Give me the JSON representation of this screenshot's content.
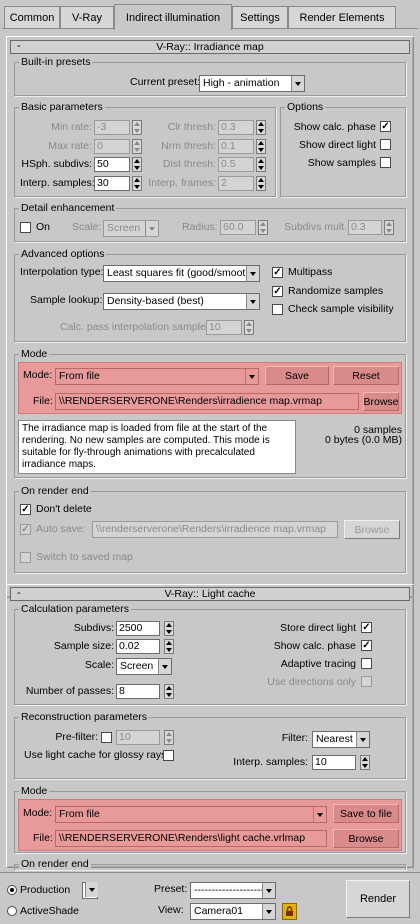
{
  "tabs": [
    {
      "label": "Common"
    },
    {
      "label": "V-Ray"
    },
    {
      "label": "Indirect illumination"
    },
    {
      "label": "Settings"
    },
    {
      "label": "Render Elements"
    }
  ],
  "irradiance": {
    "rollout_title": "V-Ray:: Irradiance map",
    "collapse": "-",
    "presets": {
      "group": "Built-in presets",
      "label": "Current preset:",
      "value": "High - animation"
    },
    "basic": {
      "group": "Basic parameters",
      "min_rate_label": "Min rate:",
      "min_rate": "-3",
      "max_rate_label": "Max rate:",
      "max_rate": "0",
      "hsph_label": "HSph. subdivs:",
      "hsph": "50",
      "interp_label": "Interp. samples:",
      "interp": "30",
      "clr_label": "Clr thresh:",
      "clr": "0.3",
      "nrm_label": "Nrm thresh:",
      "nrm": "0.1",
      "dist_label": "Dist thresh:",
      "dist": "0.5",
      "frames_label": "Interp. frames:",
      "frames": "2"
    },
    "options": {
      "group": "Options",
      "show_calc": "Show calc. phase",
      "show_direct": "Show direct light",
      "show_samples": "Show samples"
    },
    "detail": {
      "group": "Detail enhancement",
      "on": "On",
      "scale_label": "Scale:",
      "scale": "Screen",
      "radius_label": "Radius:",
      "radius": "60.0",
      "subdivs_label": "Subdivs mult.",
      "subdivs": "0.3"
    },
    "advanced": {
      "group": "Advanced options",
      "interp_type_label": "Interpolation type:",
      "interp_type": "Least squares fit (good/smooth",
      "lookup_label": "Sample lookup:",
      "lookup": "Density-based (best)",
      "calc_pass_label": "Calc. pass interpolation samples:",
      "calc_pass": "10",
      "multipass": "Multipass",
      "randomize": "Randomize samples",
      "visibility": "Check sample visibility"
    },
    "mode": {
      "group": "Mode",
      "mode_label": "Mode:",
      "mode": "From file",
      "save": "Save",
      "reset": "Reset",
      "file_label": "File:",
      "file": "\\\\RENDERSERVERONE\\Renders\\irradience map.vrmap",
      "browse": "Browse",
      "description": "The irradiance map is loaded from file at the start of the\nrendering. No new samples are computed. This mode is\nsuitable for fly-through animations with precalculated\nirradiance maps.",
      "samples": "0 samples",
      "bytes": "0 bytes (0.0 MB)"
    },
    "end": {
      "group": "On render end",
      "dont_delete": "Don't delete",
      "auto_save": "Auto save:",
      "auto_path": "\\\\renderserverone\\Renders\\irradience map.vrmap",
      "browse": "Browse",
      "switch": "Switch to saved map"
    }
  },
  "lightcache": {
    "rollout_title": "V-Ray:: Light cache",
    "collapse": "-",
    "calc": {
      "group": "Calculation parameters",
      "subdivs_label": "Subdivs:",
      "subdivs": "2500",
      "size_label": "Sample size:",
      "size": "0.02",
      "scale_label": "Scale:",
      "scale": "Screen",
      "passes_label": "Number of passes:",
      "passes": "8",
      "store_direct": "Store direct light",
      "show_calc": "Show calc. phase",
      "adaptive": "Adaptive tracing",
      "use_dirs": "Use directions only"
    },
    "recon": {
      "group": "Reconstruction parameters",
      "prefilter_label": "Pre-filter:",
      "prefilter": "10",
      "glossy": "Use light cache for glossy rays",
      "filter_label": "Filter:",
      "filter": "Nearest",
      "interp_label": "Interp. samples:",
      "interp": "10"
    },
    "mode": {
      "group": "Mode",
      "mode_label": "Mode:",
      "mode": "From file",
      "save": "Save to file",
      "file_label": "File:",
      "file": "\\\\RENDERSERVERONE\\Renders\\light cache.vrlmap",
      "browse": "Browse"
    },
    "end": {
      "group": "On render end"
    }
  },
  "footer": {
    "production": "Production",
    "activeshade": "ActiveShade",
    "production_dd": "Production",
    "preset_label": "Preset:",
    "preset": "--------------------",
    "view_label": "View:",
    "view": "Camera01",
    "render": "Render"
  }
}
